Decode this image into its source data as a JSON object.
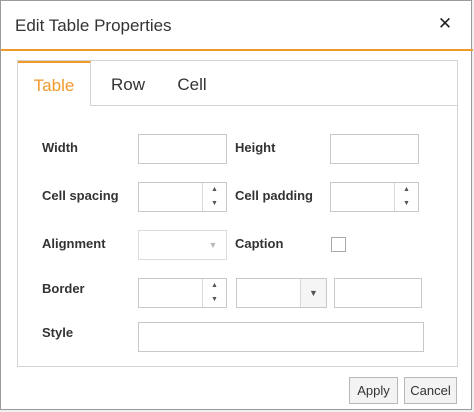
{
  "dialog": {
    "title": "Edit Table Properties",
    "close_icon": "close-icon"
  },
  "tabs": [
    {
      "label": "Table",
      "active": true
    },
    {
      "label": "Row",
      "active": false
    },
    {
      "label": "Cell",
      "active": false
    }
  ],
  "form": {
    "width_label": "Width",
    "height_label": "Height",
    "cell_spacing_label": "Cell spacing",
    "cell_padding_label": "Cell padding",
    "alignment_label": "Alignment",
    "caption_label": "Caption",
    "border_label": "Border",
    "style_label": "Style",
    "caption_checked": false
  },
  "buttons": {
    "apply": "Apply",
    "cancel": "Cancel"
  },
  "colors": {
    "accent": "#f09a2b"
  }
}
